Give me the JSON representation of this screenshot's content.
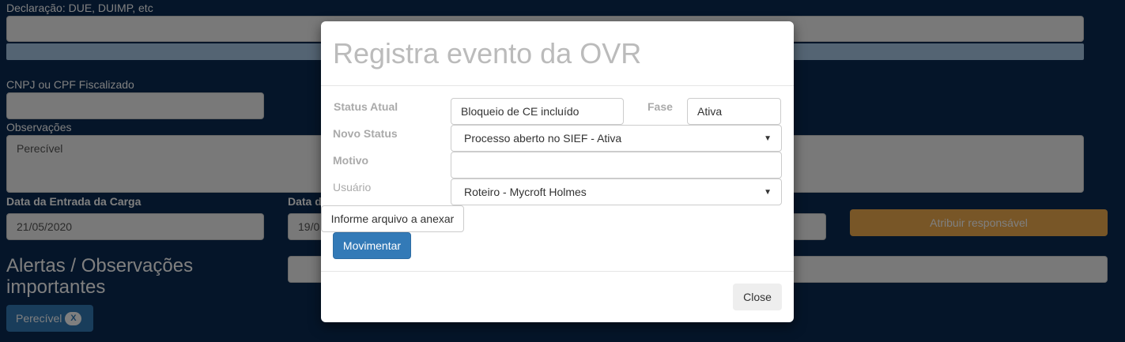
{
  "background": {
    "declaracao_label": "Declaração: DUE, DUIMP, etc",
    "cnpj_label": "CNPJ ou CPF Fiscalizado",
    "observacoes_label": "Observações",
    "observacoes_value": "Perecível",
    "data_entrada_label": "Data da Entrada da Carga",
    "data_entrada_value": "21/05/2020",
    "data_second_label": "Data d",
    "data_second_value": "19/0",
    "atribuir_button": "Atribuir responsável",
    "alertas_title_line1": "Alertas / Observações",
    "alertas_title_line2": "importantes",
    "tag_label": "Perecível",
    "tag_remove": "X"
  },
  "modal": {
    "title": "Registra evento da OVR",
    "status_atual_label": "Status Atual",
    "status_atual_value": "Bloqueio de CE incluído",
    "fase_label": "Fase",
    "fase_value": "Ativa",
    "novo_status_label": "Novo Status",
    "novo_status_value": "Processo aberto no SIEF - Ativa",
    "motivo_label": "Motivo",
    "motivo_value": "",
    "usuario_label": "Usuário",
    "usuario_value": "Roteiro - Mycroft Holmes",
    "file_button": "Informe arquivo a anexar",
    "movimentar_button": "Movimentar",
    "close_button": "Close"
  },
  "colors": {
    "page_background": "#0a2a52",
    "primary": "#337ab7",
    "warning": "#f0ad4e"
  }
}
